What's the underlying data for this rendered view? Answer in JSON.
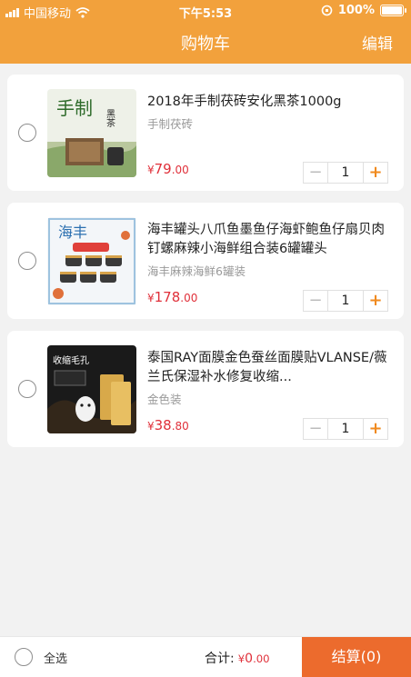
{
  "status_bar": {
    "carrier": "中国移动",
    "time": "下午5:53",
    "battery": "100%"
  },
  "header": {
    "title": "购物车",
    "edit_label": "编辑"
  },
  "items": [
    {
      "title": "2018年手制茯砖安化黑茶1000g",
      "subtitle": "手制茯砖",
      "currency": "¥",
      "price_int": "79",
      "price_dec": ".00",
      "quantity": "1"
    },
    {
      "title": "海丰罐头八爪鱼墨鱼仔海虾鲍鱼仔扇贝肉钉螺麻辣小海鲜组合装6罐罐头",
      "subtitle": "海丰麻辣海鲜6罐装",
      "currency": "¥",
      "price_int": "178",
      "price_dec": ".00",
      "quantity": "1"
    },
    {
      "title": "泰国RAY面膜金色蚕丝面膜贴VLANSE/薇兰氏保湿补水修复收缩...",
      "subtitle": "金色装",
      "currency": "¥",
      "price_int": "38",
      "price_dec": ".80",
      "quantity": "1"
    }
  ],
  "image_text": {
    "tea_top": "手制",
    "tea_side": "黑茶",
    "seafood_top": "海丰",
    "mask_top": "收缩毛孔"
  },
  "footer": {
    "select_all": "全选",
    "total_label": "合计:",
    "total_currency": "¥",
    "total_int": "0",
    "total_dec": ".00",
    "checkout_label": "结算(0)"
  },
  "colors": {
    "header": "#f2a13c",
    "price": "#e0303a",
    "checkout": "#ec6b2d",
    "plus": "#f08a1e"
  }
}
